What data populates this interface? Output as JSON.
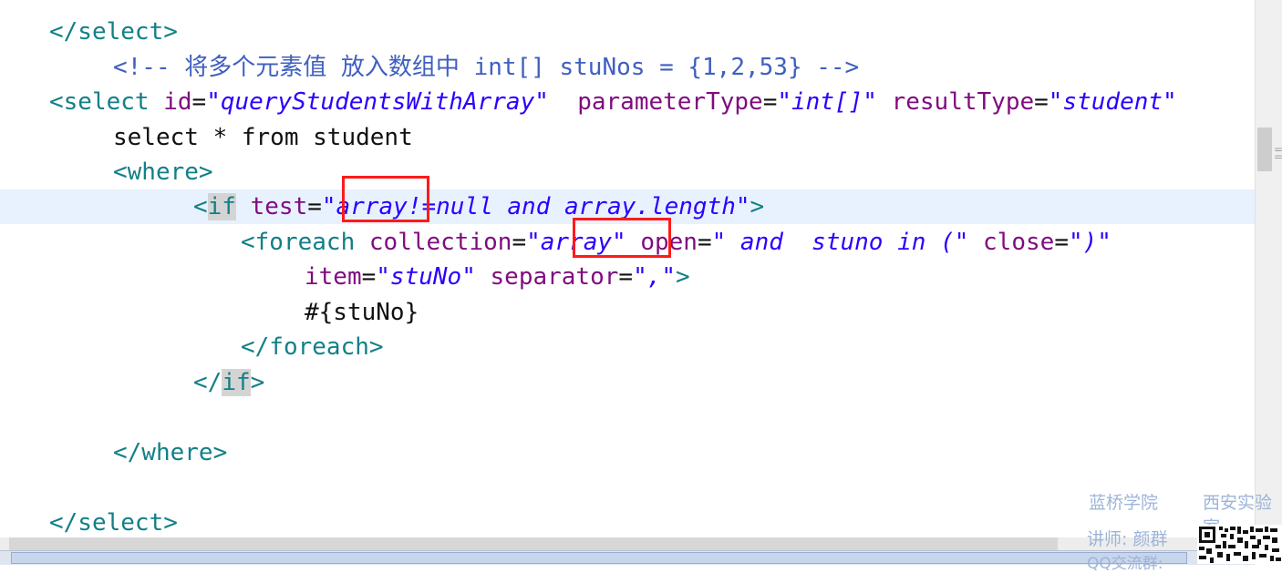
{
  "code_lines": {
    "l1": {
      "a": "</select>"
    },
    "l2": {
      "a": "<!-- 将多个元素值 放入数组中 int[] stuNos = {1,2,53} -->"
    },
    "l3": {
      "a": "<select ",
      "b": "id",
      "c": "=",
      "d": "\"queryStudentsWithArray\"",
      "e": "  ",
      "f": "parameterType",
      "g": "=",
      "h": "\"int[]\"",
      "i": " ",
      "j": "resultType",
      "k": "=",
      "l": "\"student\""
    },
    "l4": {
      "a": "select * from student"
    },
    "l5": {
      "a": "<where>"
    },
    "l6": {
      "a": "<",
      "b": "if",
      "c": " ",
      "d": "test",
      "e": "=",
      "f": "\"array!=null and array.length\"",
      "g": ">"
    },
    "l7": {
      "a": "<foreach ",
      "b": "collection",
      "c": "=",
      "d": "\"array\"",
      "e": " ",
      "f": "open",
      "g": "=",
      "h": "\" and  stuno in (\"",
      "i": " ",
      "j": "close",
      "k": "=",
      "l": "\")\""
    },
    "l8": {
      "a": "item",
      "b": "=",
      "c": "\"stuNo\"",
      "d": " ",
      "e": "separator",
      "f": "=",
      "g": "\",\"",
      "h": ">"
    },
    "l9": {
      "a": "#{stuNo}"
    },
    "l10": {
      "a": "</foreach>"
    },
    "l11": {
      "a": "</",
      "b": "if",
      "c": ">"
    },
    "l12": {
      "a": "</where>"
    },
    "l13": {
      "a": "</select>"
    }
  },
  "watermark": {
    "academy": "蓝桥学院",
    "lab": "西安实验室",
    "teacher": "讲师: 颜群",
    "qq_group": "QQ交流群:"
  },
  "colors": {
    "tag": "#127f87",
    "attribute": "#7f0c7f",
    "value": "#2a00ff",
    "comment": "#3f5fbf",
    "highlight_box": "#ff1a1a",
    "current_line": "#e8f2fe"
  }
}
